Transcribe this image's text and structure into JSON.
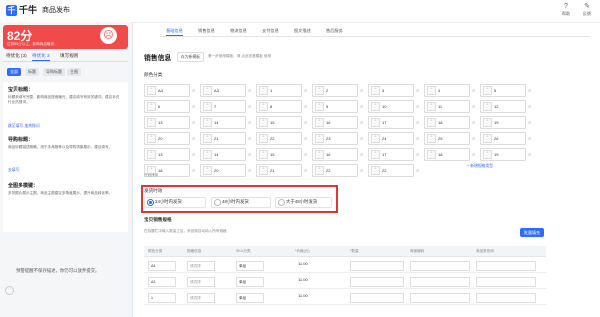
{
  "app": {
    "logo_mark": "千",
    "logo_text": "千牛",
    "page_title": "商品发布"
  },
  "toolbar": [
    {
      "label": "帮助",
      "icon": "help-icon",
      "glyph": "?"
    },
    {
      "label": "反馈",
      "icon": "feedback-icon",
      "glyph": "✎"
    }
  ],
  "score": {
    "value": "82分",
    "subtitle": "达到85分以上，影响商品曝光...",
    "face": "☹"
  },
  "left_tabs": [
    {
      "label": "待优化 (3)",
      "active": false
    },
    {
      "label": "待优化 3",
      "active": true
    },
    {
      "label": "填写规则",
      "active": false
    }
  ],
  "chips": [
    {
      "label": "全部",
      "active": true
    },
    {
      "label": "标题",
      "active": false
    },
    {
      "label": "导购标题",
      "active": false
    },
    {
      "label": "主图",
      "active": false
    }
  ],
  "tips": [
    {
      "title": "宝贝标题：",
      "body": "标题未填写完整，影响商品搜索曝光，建议填写有效关键词，建议补充行业热搜词。",
      "link": "跳至填写-加热搜词"
    },
    {
      "title": "导购标题：",
      "body": "商品标题描述精确，用于手淘推荐以及导购场景展示，建议填写。",
      "link": "去填写"
    },
    {
      "title": "全图多模键：",
      "body": "多张图片展示主图，商品主图建议多角度展示，提升商品转化率。",
      "link": ""
    }
  ],
  "left_footer": "预警提醒不保存描述，你仍可以放弃提交。",
  "nav_tabs": [
    {
      "label": "基础信息",
      "active": true
    },
    {
      "label": "销售信息",
      "active": false
    },
    {
      "label": "物流信息",
      "active": false
    },
    {
      "label": "支付信息",
      "active": false
    },
    {
      "label": "图文描述",
      "active": false
    },
    {
      "label": "售后服务",
      "active": false
    }
  ],
  "sales": {
    "title": "销售信息",
    "template_btn": "存为新模板",
    "hint": "第一步使用模板，请 点此查看模板 使用",
    "color_label": "颜色分类",
    "add_label": "+ 新增规格类型",
    "open_hint": "开启排序",
    "colors": [
      [
        "A4",
        "A3",
        "1",
        "2",
        "3",
        "4",
        "5"
      ],
      [
        "6",
        "7",
        "8",
        "9",
        "10",
        "11",
        "12"
      ],
      [
        "13",
        "14",
        "15",
        "16",
        "17",
        "18",
        "19"
      ],
      [
        "20",
        "21",
        "22",
        "23",
        "24",
        "25",
        "26"
      ],
      [
        "13",
        "14",
        "15",
        "16",
        "17",
        "18",
        "19"
      ],
      [
        "18",
        "20",
        "21",
        "22",
        "22",
        "",
        ""
      ]
    ]
  },
  "shipping": {
    "label": "发货时效",
    "options": [
      {
        "label": "24小时内发货",
        "checked": true
      },
      {
        "label": "48小时内发货",
        "checked": false
      },
      {
        "label": "大于48小时发货",
        "checked": false
      }
    ]
  },
  "spec": {
    "title": "宝贝销售规格",
    "hint": "在标题栏中输入数量之后，系统将自动填入所有规格",
    "button": "批量填充",
    "headers": [
      "颜色分类",
      "规格信息",
      "SKU分类",
      "*价格(元)",
      "*数量",
      "商家编码",
      "商品条形码"
    ],
    "rows": [
      {
        "color": "A4",
        "spec": "请选择",
        "sku": "单品",
        "price": "11.00"
      },
      {
        "color": "A3",
        "spec": "请选择",
        "sku": "单品",
        "price": "11.00"
      },
      {
        "color": "1",
        "spec": "请选择",
        "sku": "单品",
        "price": "11.00"
      }
    ]
  }
}
